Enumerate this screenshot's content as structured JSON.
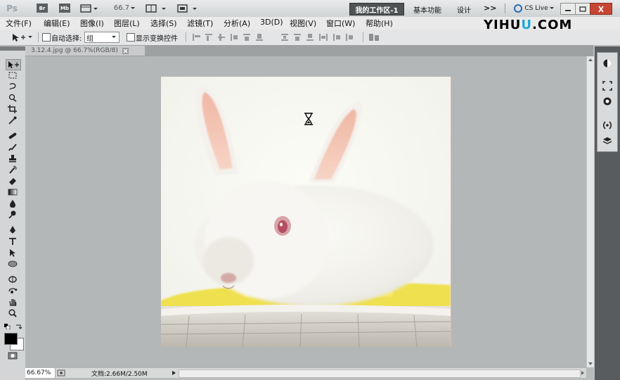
{
  "appbar": {
    "app_logo": "Ps",
    "br_label": "Br",
    "mb_label": "Mb",
    "zoom_value": "66.7",
    "more_label": ">>",
    "workspace_active": "我的工作区-1",
    "workspace_basic": "基本功能",
    "workspace_design": "设计",
    "cs_live": "CS Live",
    "accent": "#4f5355"
  },
  "menu": {
    "items": [
      "文件(F)",
      "编辑(E)",
      "图像(I)",
      "图层(L)",
      "选择(S)",
      "滤镜(T)",
      "分析(A)",
      "3D(D)",
      "视图(V)",
      "窗口(W)",
      "帮助(H)"
    ]
  },
  "watermark": {
    "left": "YIHU",
    "right": ".COM",
    "highlight": "U",
    "color": "#1da8d8"
  },
  "options": {
    "auto_select_label": "自动选择:",
    "auto_select_value": "组",
    "show_transform_label": "显示变换控件"
  },
  "document": {
    "tab_title": "3.12.4.jpg @ 66.7%(RGB/8)"
  },
  "status": {
    "zoom": "66.67%",
    "doc_size": "文档:2.66M/2.50M"
  },
  "colors": {
    "foreground": "#000000",
    "background": "#ffffff"
  }
}
